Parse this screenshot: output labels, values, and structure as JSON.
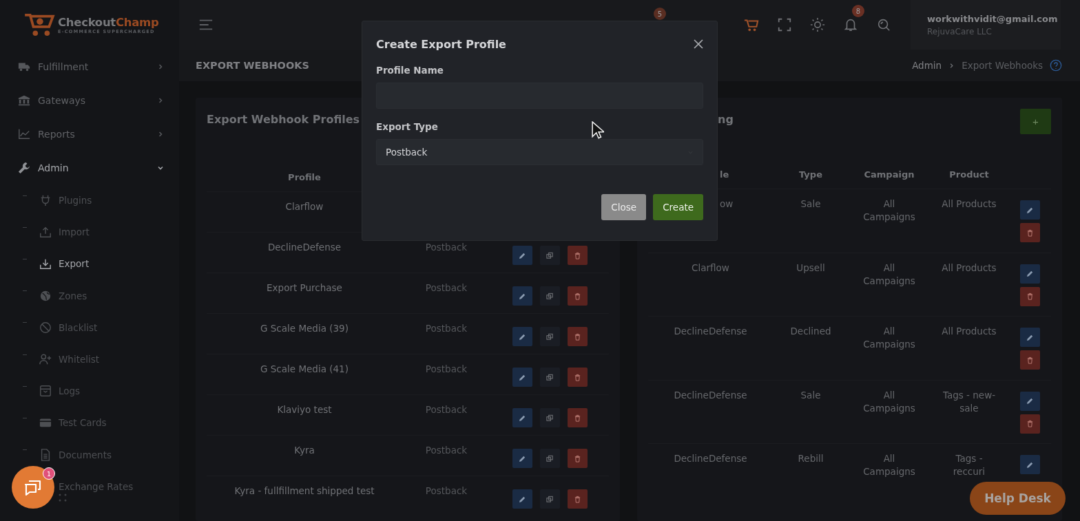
{
  "logo": {
    "name_first": "Checkout",
    "name_second": "Champ",
    "tagline": "E-COMMERCE SUPERCHARGED"
  },
  "sidebar": {
    "items": [
      {
        "label": "Fulfillment",
        "expanded": false
      },
      {
        "label": "Gateways",
        "expanded": false
      },
      {
        "label": "Reports",
        "expanded": false
      },
      {
        "label": "Admin",
        "expanded": true,
        "children": [
          {
            "label": "Plugins",
            "selected": false
          },
          {
            "label": "Import",
            "selected": false
          },
          {
            "label": "Export",
            "selected": true
          },
          {
            "label": "Zones",
            "selected": false
          },
          {
            "label": "Blacklist",
            "selected": false
          },
          {
            "label": "Whitelist",
            "selected": false
          },
          {
            "label": "Logs",
            "selected": false
          },
          {
            "label": "Test Cards",
            "selected": false
          },
          {
            "label": "Documents",
            "selected": false
          },
          {
            "label": "Exchange Rates",
            "selected": false
          }
        ]
      }
    ]
  },
  "topbar": {
    "hidden_badge": "5",
    "icons": [
      {
        "kind": "cart"
      },
      {
        "kind": "fullscreen"
      },
      {
        "kind": "sun"
      },
      {
        "kind": "bell",
        "badge": "8"
      },
      {
        "kind": "search"
      }
    ],
    "user": {
      "email": "workwithvidit@gmail.com",
      "company": "RejuvaCare LLC"
    }
  },
  "page": {
    "title": "EXPORT WEBHOOKS",
    "breadcrumb": [
      "Admin",
      "Export Webhooks"
    ]
  },
  "profiles_card": {
    "title": "Export Webhook Profiles",
    "columns": [
      "Profile"
    ],
    "rows": [
      {
        "profile": "Clarflow",
        "buttons": []
      },
      {
        "profile": "DeclineDefense",
        "type": "Postback",
        "buttons": [
          {
            "kind": "edit"
          },
          {
            "kind": "copy"
          },
          {
            "kind": "delete"
          }
        ]
      },
      {
        "profile": "Export Purchase",
        "type": "Postback",
        "buttons": [
          {
            "kind": "edit"
          },
          {
            "kind": "copy"
          },
          {
            "kind": "delete"
          }
        ]
      },
      {
        "profile": "G Scale Media (39)",
        "type": "Postback",
        "buttons": [
          {
            "kind": "edit"
          },
          {
            "kind": "copy"
          },
          {
            "kind": "delete"
          }
        ]
      },
      {
        "profile": "G Scale Media (41)",
        "type": "Postback",
        "buttons": [
          {
            "kind": "edit"
          },
          {
            "kind": "copy"
          },
          {
            "kind": "delete"
          }
        ]
      },
      {
        "profile": "Klaviyo test",
        "type": "Postback",
        "buttons": [
          {
            "kind": "edit"
          },
          {
            "kind": "copy"
          },
          {
            "kind": "delete"
          }
        ]
      },
      {
        "profile": "Kyra",
        "type": "Postback",
        "buttons": [
          {
            "kind": "edit"
          },
          {
            "kind": "copy"
          },
          {
            "kind": "delete"
          }
        ]
      },
      {
        "profile": "Kyra - fullfillment shipped test",
        "type": "Postback",
        "buttons": [
          {
            "kind": "edit"
          },
          {
            "kind": "copy"
          },
          {
            "kind": "delete"
          }
        ]
      }
    ]
  },
  "mapping_card": {
    "title": "ng",
    "add_button": "+",
    "columns": [
      "le",
      "Type",
      "Campaign",
      "Product"
    ],
    "rows": [
      {
        "profile": "ow",
        "type": "Sale",
        "campaign": "All Campaigns",
        "product": "All Products",
        "buttons": [
          {
            "kind": "edit"
          },
          {
            "kind": "delete"
          }
        ]
      },
      {
        "profile": "Clarflow",
        "type": "Upsell",
        "campaign": "All Campaigns",
        "product": "All Products",
        "buttons": [
          {
            "kind": "edit"
          },
          {
            "kind": "delete"
          }
        ]
      },
      {
        "profile": "DeclineDefense",
        "type": "Declined",
        "campaign": "All Campaigns",
        "product": "All Products",
        "buttons": [
          {
            "kind": "edit"
          },
          {
            "kind": "delete"
          }
        ]
      },
      {
        "profile": "DeclineDefense",
        "type": "Sale",
        "campaign": "All Campaigns",
        "product": "Tags - new-sale",
        "buttons": [
          {
            "kind": "edit"
          },
          {
            "kind": "delete"
          }
        ]
      },
      {
        "profile": "DeclineDefense",
        "type": "Rebill",
        "campaign": "All Campaigns",
        "product": "Tags - reccuri",
        "buttons": [
          {
            "kind": "edit"
          }
        ]
      }
    ]
  },
  "modal": {
    "title": "Create Export Profile",
    "fields": [
      {
        "kind": "text",
        "label": "Profile Name"
      },
      {
        "kind": "select",
        "label": "Export Type",
        "value": "Postback"
      }
    ],
    "buttons": [
      {
        "kind": "secondary",
        "label": "Close"
      },
      {
        "kind": "primary",
        "label": "Create"
      }
    ]
  },
  "chat": {
    "badge": "1"
  },
  "help_desk": {
    "label": "Help Desk"
  }
}
